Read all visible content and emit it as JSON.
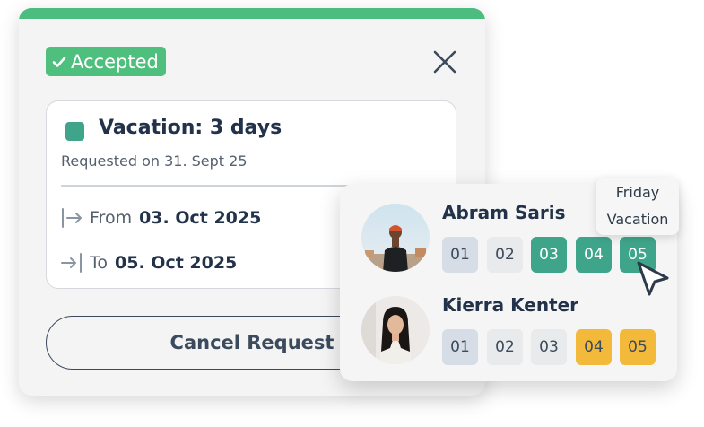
{
  "request": {
    "status_label": "Accepted",
    "title": "Vacation: 3 days",
    "requested_on": "Requested on 31. Sept 25",
    "from_label": "From",
    "from_date": "03. Oct 2025",
    "to_label": "To",
    "to_date": "05. Oct 2025",
    "cancel_label": "Cancel Request"
  },
  "colors": {
    "accent_green": "#4cbd7f",
    "vacation_teal": "#3fa58a",
    "day_yellow": "#f2b93b",
    "day_blue": "#d6dde6",
    "day_gray": "#e9eaec"
  },
  "team": [
    {
      "name": "Abram Saris",
      "days": [
        {
          "label": "01",
          "state": "blue"
        },
        {
          "label": "02",
          "state": "gray"
        },
        {
          "label": "03",
          "state": "teal"
        },
        {
          "label": "04",
          "state": "teal"
        },
        {
          "label": "05",
          "state": "teal"
        }
      ]
    },
    {
      "name": "Kierra Kenter",
      "days": [
        {
          "label": "01",
          "state": "blue"
        },
        {
          "label": "02",
          "state": "gray"
        },
        {
          "label": "03",
          "state": "gray"
        },
        {
          "label": "04",
          "state": "yellow"
        },
        {
          "label": "05",
          "state": "yellow"
        }
      ]
    }
  ],
  "tooltip": {
    "day": "Friday",
    "type": "Vacation"
  }
}
